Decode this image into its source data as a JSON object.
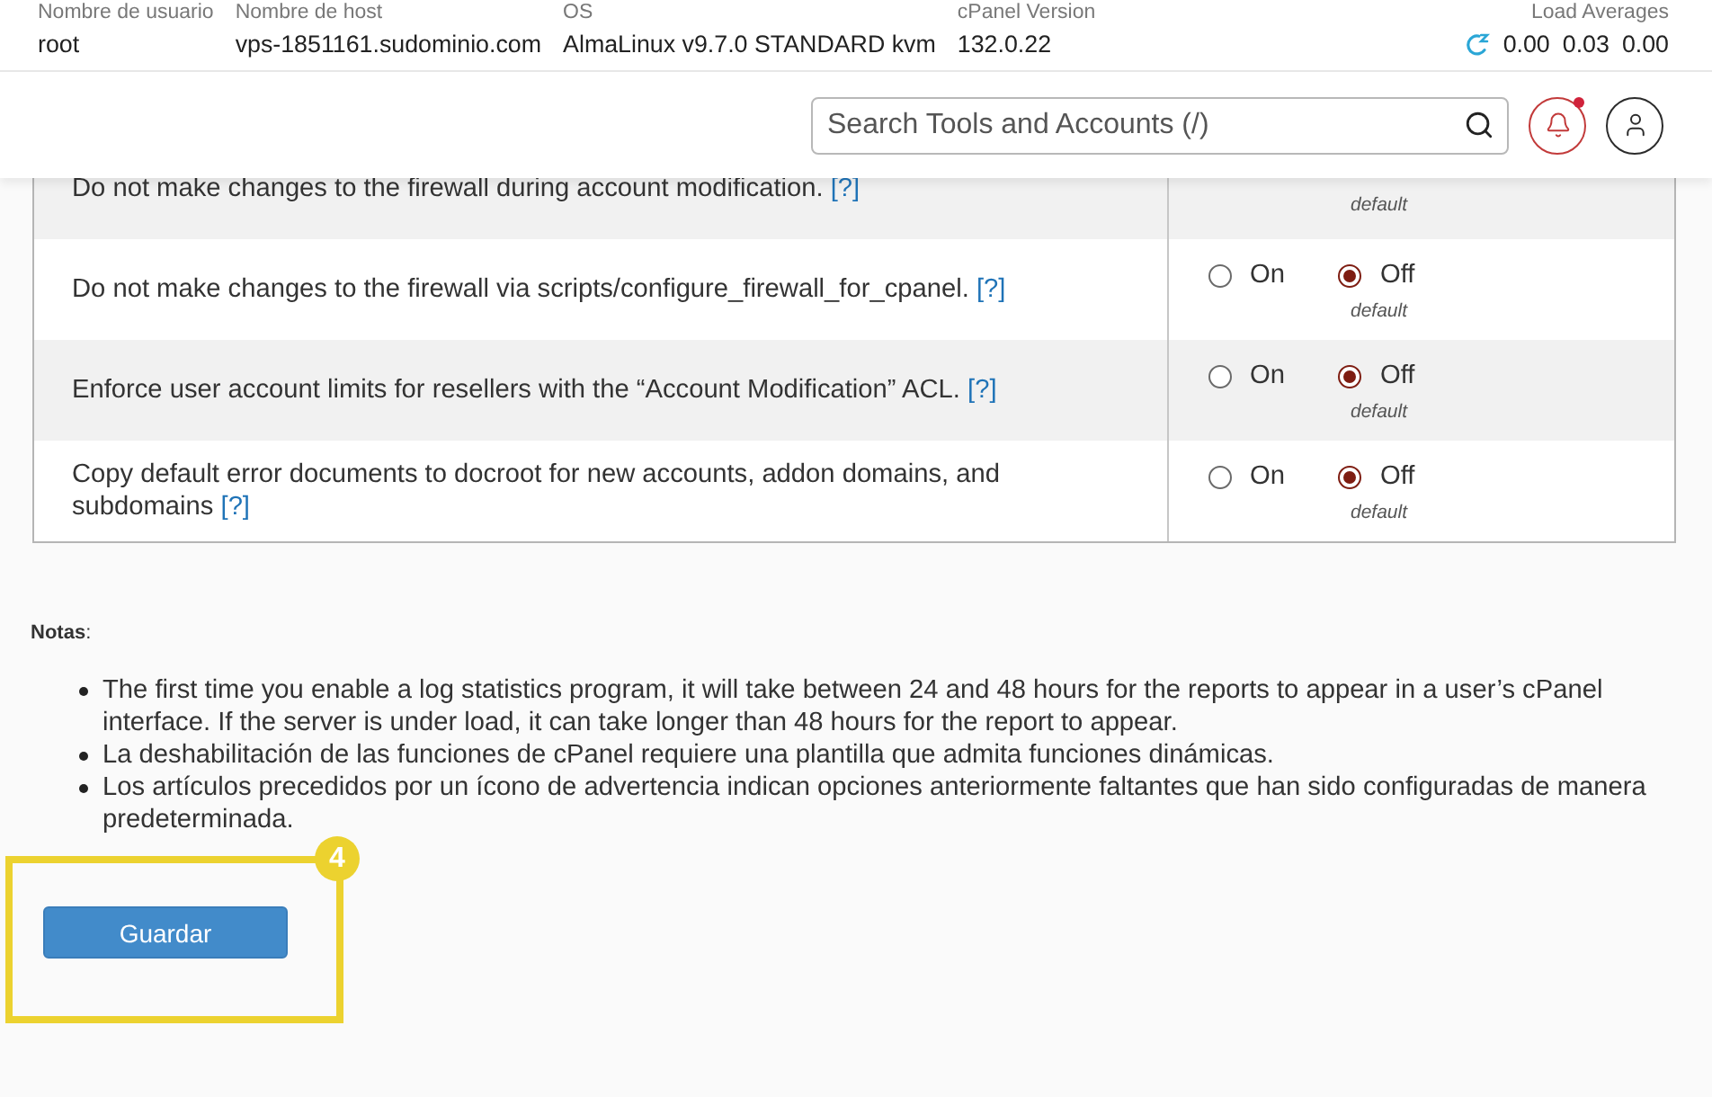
{
  "server_info": [
    {
      "label": "Nombre de usuario",
      "value": "root"
    },
    {
      "label": "Nombre de host",
      "value": "vps-1851161.sudominio.com"
    },
    {
      "label": "OS",
      "value": "AlmaLinux v9.7.0 STANDARD kvm"
    },
    {
      "label": "cPanel Version",
      "value": "132.0.22"
    }
  ],
  "load_averages": {
    "label": "Load Averages",
    "values": [
      "0.00",
      "0.03",
      "0.00"
    ]
  },
  "search": {
    "placeholder": "Search Tools and Accounts (/)"
  },
  "notifications": {
    "unread": true
  },
  "settings": [
    {
      "text": "Do not make changes to the firewall during account modification.",
      "help": "[?]",
      "note": "default"
    },
    {
      "text": "Do not make changes to the firewall via scripts/configure_firewall_for_cpanel.",
      "help": "[?]",
      "options": [
        {
          "label": "On",
          "selected": false
        },
        {
          "label": "Off",
          "selected": true
        }
      ],
      "note": "default"
    },
    {
      "text": "Enforce user account limits for resellers with the “Account Modification” ACL.",
      "help": "[?]",
      "options": [
        {
          "label": "On",
          "selected": false
        },
        {
          "label": "Off",
          "selected": true
        }
      ],
      "note": "default"
    },
    {
      "text": "Copy default error documents to docroot for new accounts, addon domains, and subdomains",
      "help": "[?]",
      "options": [
        {
          "label": "On",
          "selected": false
        },
        {
          "label": "Off",
          "selected": true
        }
      ],
      "note": "default"
    }
  ],
  "notes": {
    "title": "**Notas**:",
    "items": [
      "The first time you enable a log statistics program, it will take between 24 and 48 hours for the reports to appear in a user’s cPanel interface. If the server is under load, it can take longer than 48 hours for the report to appear.",
      "La deshabilitación de las funciones de cPanel requiere una plantilla que admita funciones dinámicas.",
      "Los artículos precedidos por un ícono de advertencia indican opciones anteriormente faltantes que han sido configuradas de manera predeterminada."
    ]
  },
  "save_button": {
    "label": "Guardar"
  },
  "annotation": {
    "number": "4"
  }
}
